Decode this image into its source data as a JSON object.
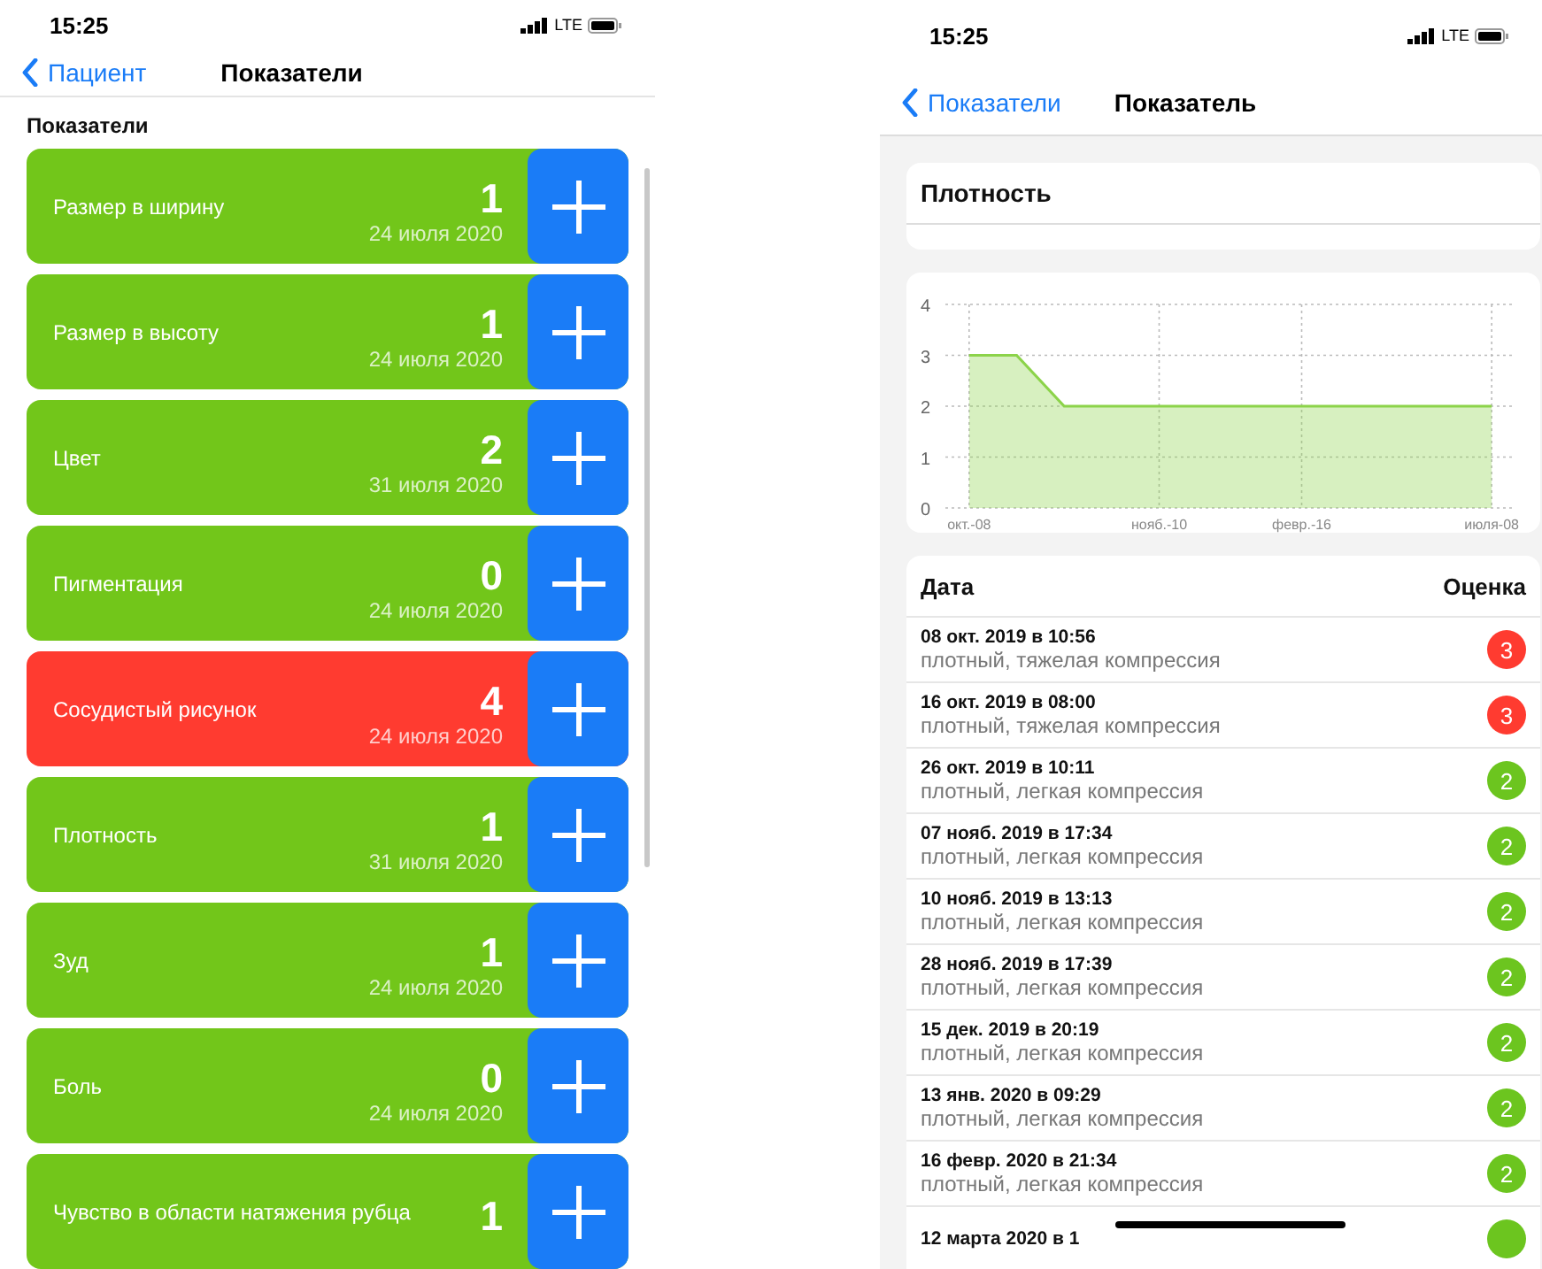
{
  "left_screen": {
    "status_bar": {
      "time": "15:25",
      "network": "LTE"
    },
    "nav": {
      "back": "Пациент",
      "title": "Показатели"
    },
    "section_title": "Показатели",
    "indicators": [
      {
        "name": "Размер в ширину",
        "value": "1",
        "date": "24 июля 2020",
        "color": "#72c61a"
      },
      {
        "name": "Размер в высоту",
        "value": "1",
        "date": "24 июля 2020",
        "color": "#72c61a"
      },
      {
        "name": "Цвет",
        "value": "2",
        "date": "31 июля 2020",
        "color": "#72c61a"
      },
      {
        "name": "Пигментация",
        "value": "0",
        "date": "24 июля 2020",
        "color": "#72c61a"
      },
      {
        "name": "Сосудистый рисунок",
        "value": "4",
        "date": "24 июля 2020",
        "color": "#ff3b30"
      },
      {
        "name": "Плотность",
        "value": "1",
        "date": "31 июля 2020",
        "color": "#72c61a"
      },
      {
        "name": "Зуд",
        "value": "1",
        "date": "24 июля 2020",
        "color": "#72c61a"
      },
      {
        "name": "Боль",
        "value": "0",
        "date": "24 июля 2020",
        "color": "#72c61a"
      },
      {
        "name": "Чувство в области натяжения рубца",
        "value": "1",
        "color": "#72c61a"
      }
    ]
  },
  "right_screen": {
    "status_bar": {
      "time": "15:25",
      "network": "LTE"
    },
    "nav": {
      "back": "Показатели",
      "title": "Показатель"
    },
    "indicator_title": "Плотность",
    "chart": {
      "chart_data": {
        "type": "area",
        "categories": [
          "окт.-08",
          null,
          null,
          null,
          "нояб.-10",
          null,
          null,
          "февр.-16",
          null,
          null,
          null,
          "июля-08"
        ],
        "series": [
          {
            "color": "#8cd34a",
            "values": [
              3,
              3,
              2,
              2,
              2,
              2,
              2,
              2,
              2,
              2,
              2,
              2
            ]
          }
        ],
        "ylim": [
          0,
          4
        ],
        "yticks": [
          0,
          1,
          2,
          3,
          4
        ],
        "grid": true
      }
    },
    "table": {
      "columns": [
        "Дата",
        "Оценка"
      ],
      "rows": [
        {
          "date": "08 окт. 2019 в 10:56",
          "note": "плотный, тяжелая компрессия",
          "score": "3",
          "color": "#ff3b30"
        },
        {
          "date": "16 окт. 2019 в 08:00",
          "note": "плотный, тяжелая компрессия",
          "score": "3",
          "color": "#ff3b30"
        },
        {
          "date": "26 окт. 2019 в 10:11",
          "note": "плотный, легкая компрессия",
          "score": "2",
          "color": "#6cc51f"
        },
        {
          "date": "07 нояб. 2019 в 17:34",
          "note": "плотный, легкая компрессия",
          "score": "2",
          "color": "#6cc51f"
        },
        {
          "date": "10 нояб. 2019 в 13:13",
          "note": "плотный, легкая компрессия",
          "score": "2",
          "color": "#6cc51f"
        },
        {
          "date": "28 нояб. 2019 в 17:39",
          "note": "плотный, легкая компрессия",
          "score": "2",
          "color": "#6cc51f"
        },
        {
          "date": "15 дек. 2019 в 20:19",
          "note": "плотный, легкая компрессия",
          "score": "2",
          "color": "#6cc51f"
        },
        {
          "date": "13 янв. 2020 в 09:29",
          "note": "плотный, легкая компрессия",
          "score": "2",
          "color": "#6cc51f"
        },
        {
          "date": "16 февр. 2020 в 21:34",
          "note": "плотный, легкая компрессия",
          "score": "2",
          "color": "#6cc51f"
        },
        {
          "date": "12 марта 2020 в 1",
          "color": "#6cc51f"
        }
      ]
    }
  }
}
